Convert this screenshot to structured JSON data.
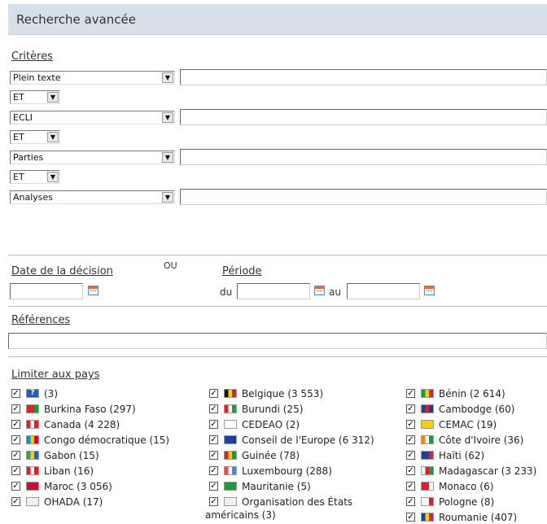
{
  "header": {
    "title": "Recherche avancée"
  },
  "criteria": {
    "label": "Critères",
    "rows": [
      {
        "field": "Plein texte",
        "operator": "ET"
      },
      {
        "field": "ECLI",
        "operator": "ET"
      },
      {
        "field": "Parties",
        "operator": "ET"
      },
      {
        "field": "Analyses",
        "operator": ""
      }
    ]
  },
  "date": {
    "decision_label": "Date de la décision",
    "ou_label": "OU",
    "period_label": "Période",
    "du_label": "du",
    "au_label": "au"
  },
  "references": {
    "label": "Références"
  },
  "countries": {
    "label": "Limiter aux pays",
    "col1": [
      {
        "name": "(3)",
        "flag": [
          "#1f5fb8",
          "#1f5fb8",
          "#1f5fb8"
        ],
        "icon": "question-icon"
      },
      {
        "name": "Burkina Faso (297)",
        "flag": [
          "#d9261c",
          "#d9261c",
          "#169b3a"
        ]
      },
      {
        "name": "Canada (4 228)",
        "flag": [
          "#d8232a",
          "#ffffff",
          "#d8232a"
        ]
      },
      {
        "name": "Congo démocratique (15)",
        "flag": [
          "#0a8fd8",
          "#f5d000",
          "#c8102e"
        ]
      },
      {
        "name": "Gabon (15)",
        "flag": [
          "#2aa84a",
          "#f5d000",
          "#2a5fb8"
        ]
      },
      {
        "name": "Liban (16)",
        "flag": [
          "#d8232a",
          "#ffffff",
          "#d8232a"
        ]
      },
      {
        "name": "Maroc (3 056)",
        "flag": [
          "#c8102e",
          "#c8102e",
          "#c8102e"
        ]
      },
      {
        "name": "OHADA (17)",
        "flag": [
          "#eef2f8",
          "#eef2f8",
          "#eef2f8"
        ]
      }
    ],
    "col2": [
      {
        "name": "Belgique (3 553)",
        "flag": [
          "#111111",
          "#f5d000",
          "#d8232a"
        ]
      },
      {
        "name": "Burundi (25)",
        "flag": [
          "#d8232a",
          "#ffffff",
          "#1e9b3a"
        ]
      },
      {
        "name": "CEDEAO (2)",
        "flag": [
          "#ffffff",
          "#ffffff",
          "#ffffff"
        ]
      },
      {
        "name": "Conseil de l'Europe (6 312)",
        "flag": [
          "#1f3f9a",
          "#1f3f9a",
          "#1f3f9a"
        ]
      },
      {
        "name": "Guinée (78)",
        "flag": [
          "#d8232a",
          "#f5d000",
          "#169b3a"
        ]
      },
      {
        "name": "Luxembourg (288)",
        "flag": [
          "#ea4a4a",
          "#ffffff",
          "#3a8fd8"
        ]
      },
      {
        "name": "Mauritanie (5)",
        "flag": [
          "#1e9b3a",
          "#1e9b3a",
          "#1e9b3a"
        ]
      },
      {
        "name": "Organisation des États",
        "name2": "américains (3)",
        "flag": [
          "#f0f0f0",
          "#f0f0f0",
          "#f0f0f0"
        ]
      }
    ],
    "col3": [
      {
        "name": "Bénin (2 614)",
        "flag": [
          "#1e9b3a",
          "#f5d000",
          "#d8232a"
        ]
      },
      {
        "name": "Cambodge (60)",
        "flag": [
          "#1f3f9a",
          "#d8232a",
          "#1f3f9a"
        ]
      },
      {
        "name": "CEMAC (19)",
        "flag": [
          "#f5d000",
          "#f5d000",
          "#f5d000"
        ]
      },
      {
        "name": "Côte d'Ivoire (36)",
        "flag": [
          "#f08a1c",
          "#ffffff",
          "#1e9b3a"
        ]
      },
      {
        "name": "Haïti (62)",
        "flag": [
          "#1f3f9a",
          "#1f3f9a",
          "#d8232a"
        ]
      },
      {
        "name": "Madagascar (3 233)",
        "flag": [
          "#ffffff",
          "#d8232a",
          "#1e9b3a"
        ]
      },
      {
        "name": "Monaco (6)",
        "flag": [
          "#d8232a",
          "#d8232a",
          "#ffffff"
        ]
      },
      {
        "name": "Pologne (8)",
        "flag": [
          "#ffffff",
          "#ffffff",
          "#d8232a"
        ]
      },
      {
        "name": "Roumanie (407)",
        "flag": [
          "#1f3f9a",
          "#f5d000",
          "#d8232a"
        ]
      }
    ],
    "checked_glyph": "☑"
  }
}
